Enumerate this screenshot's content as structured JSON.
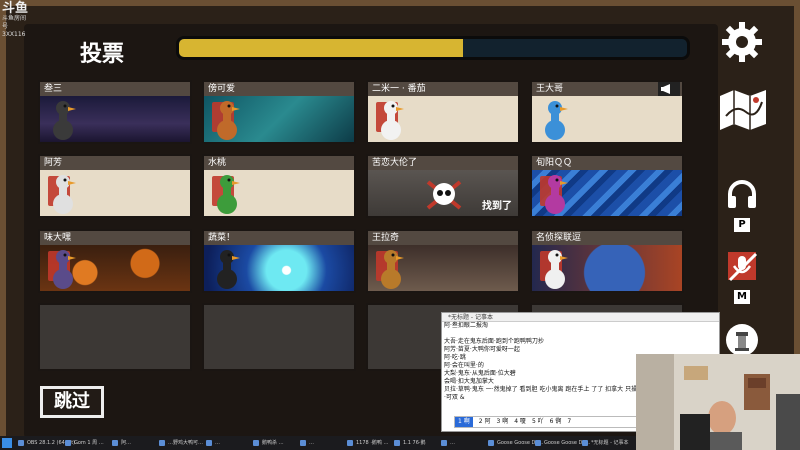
{
  "stream": {
    "logo": "斗鱼",
    "room_label": "斗鱼房间号",
    "room_id": "3XX116"
  },
  "vote": {
    "title": "投票",
    "progress": 0.56
  },
  "players": [
    {
      "name": "叁三",
      "bg": "night"
    },
    {
      "name": "傍可爱",
      "bg": "teal"
    },
    {
      "name": "二米一 · 番茄",
      "bg": "plain"
    },
    {
      "name": "王大哥",
      "bg": "plain",
      "megaphone": true
    },
    {
      "name": "阿芳",
      "bg": "plain"
    },
    {
      "name": "水桃",
      "bg": "plain"
    },
    {
      "name": "苦恋大伦了",
      "bg": "dark",
      "dead": true,
      "found_label": "找到了"
    },
    {
      "name": "旬阳ＱＱ",
      "bg": "blue"
    },
    {
      "name": "味大嘿",
      "bg": "pumpkin"
    },
    {
      "name": "蔬菜！",
      "bg": "warp"
    },
    {
      "name": "王拉奇",
      "bg": "room"
    },
    {
      "name": "名侦探联逗",
      "bg": "space"
    },
    {
      "name": "",
      "bg": "empty"
    },
    {
      "name": "",
      "bg": "empty"
    },
    {
      "name": "",
      "bg": "empty"
    },
    {
      "name": "",
      "bg": "empty"
    }
  ],
  "side": {
    "audio_key": "P",
    "mic_key": "M"
  },
  "skip_label": "跳过",
  "notepad": {
    "title": "*无标题 - 记事本",
    "lines": [
      "阿·叁扣眼二报淘",
      "",
      "大吾·走在鬼东后面·跑到个跑鸭鸭刀抄",
      "阿芳·苗夏·大鸭你可爱呀一起",
      "阿·吃·跳",
      "阿·会在叫里·的",
      "大梨·鬼东·从鬼后面·位大碧",
      "会喝·扣大鬼加掌大",
      "贝拉·草鸭·鬼东 一·然鬼掉了 看到胆 吃小鬼离 跑在手上 了了 扣拿大 只操自导 扣",
      "·可双 &"
    ],
    "ime_candidates": [
      "1 啊",
      "2 阿",
      "3 啊",
      "4 嗄",
      "5 吖",
      "6 锕",
      "7"
    ]
  },
  "taskbar": {
    "items": [
      "OBS 28.1.2 (64-bit)...",
      "Gom 1 周 …",
      "阿…",
      "…野鸡大鸭可…",
      "…",
      "鹅鸭杀 …",
      "…",
      "1178 ·鹅鸭 …",
      "1.1 76·鹅",
      "…",
      "Goose Goose Du…",
      "Goose Goose Du…",
      "*无标题 - 记事本"
    ]
  },
  "colors": {
    "accent": "#d7b531",
    "bar_bg": "#12222e",
    "frame": "#6a4f33"
  }
}
